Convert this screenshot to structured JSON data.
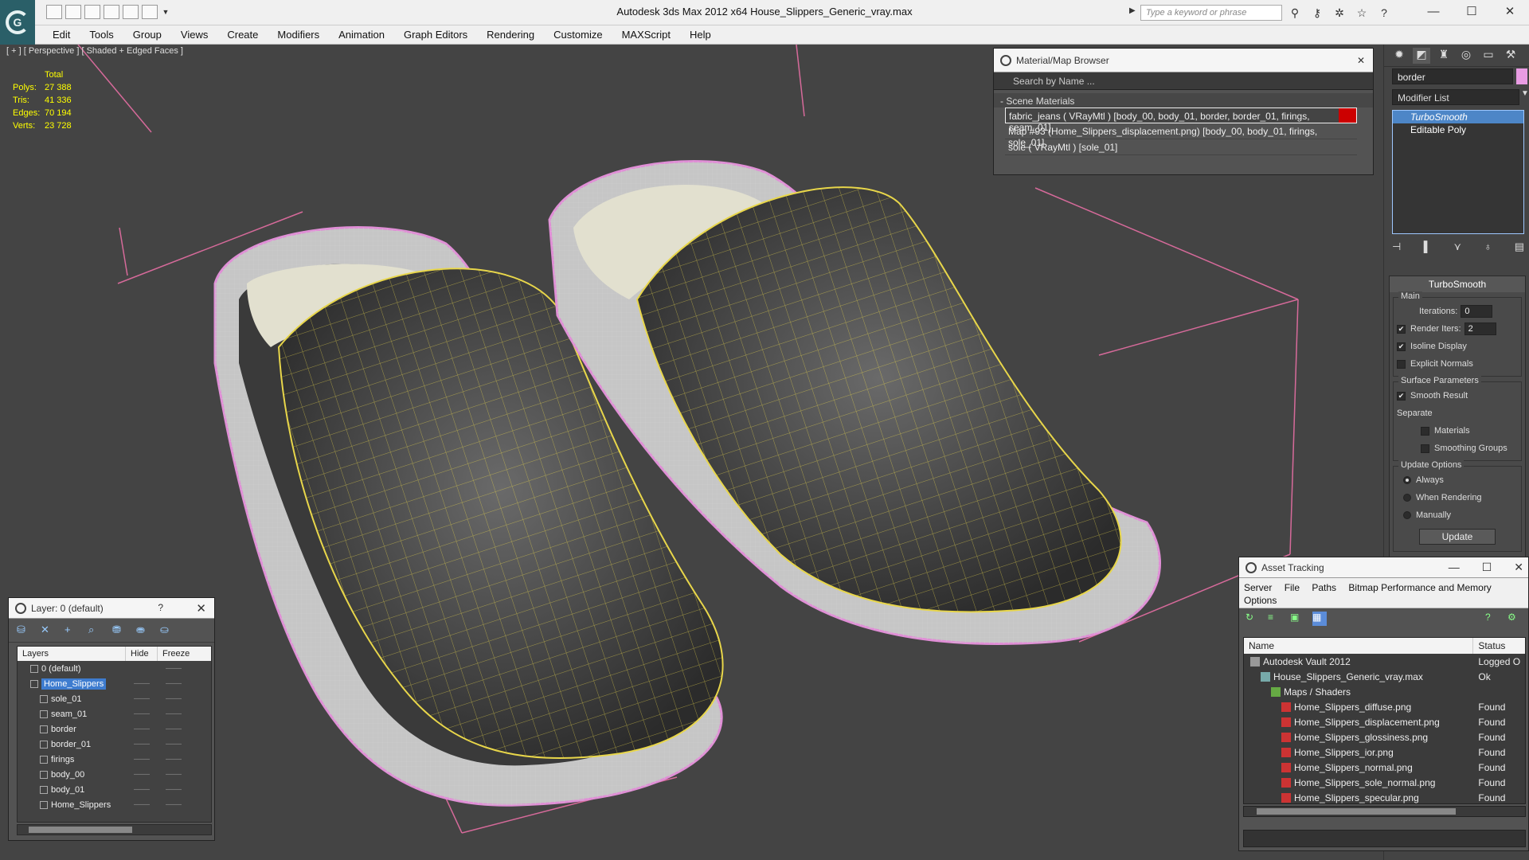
{
  "window": {
    "title": "Autodesk 3ds Max  2012 x64      House_Slippers_Generic_vray.max",
    "search_placeholder": "Type a keyword or phrase",
    "minimize": "—",
    "maximize": "☐",
    "close": "✕"
  },
  "menu": [
    "Edit",
    "Tools",
    "Group",
    "Views",
    "Create",
    "Modifiers",
    "Animation",
    "Graph Editors",
    "Rendering",
    "Customize",
    "MAXScript",
    "Help"
  ],
  "viewport": {
    "label": "[ + ] [ Perspective ] [ Shaded + Edged Faces ]",
    "stats_header": "Total",
    "stats": [
      {
        "k": "Polys:",
        "v": "27 388"
      },
      {
        "k": "Tris:",
        "v": "41 336"
      },
      {
        "k": "Edges:",
        "v": "70 194"
      },
      {
        "k": "Verts:",
        "v": "23 728"
      }
    ]
  },
  "material_browser": {
    "title": "Material/Map Browser",
    "search": "Search by Name ...",
    "section": "- Scene Materials",
    "items": [
      "fabric_jeans  ( VRayMtl )  [body_00, body_01, border, border_01, firings, seam_01]",
      "Map #93 (Home_Slippers_displacement.png) [body_00, body_01, firings, sole_01]",
      "sole  ( VRayMtl )  [sole_01]"
    ],
    "close": "✕"
  },
  "command_panel": {
    "object_name": "border",
    "object_color": "#e99ce3",
    "modifier_list": "Modifier List",
    "stack": [
      "TurboSmooth",
      "Editable Poly"
    ],
    "rollout_title": "TurboSmooth",
    "main_group": "Main",
    "iterations_label": "Iterations:",
    "iterations_value": "0",
    "render_iters_label": "Render Iters:",
    "render_iters_value": "2",
    "isoline": "Isoline Display",
    "explicit_normals": "Explicit Normals",
    "surface_group": "Surface Parameters",
    "smooth_result": "Smooth Result",
    "separate": "Separate",
    "materials": "Materials",
    "smoothing_groups": "Smoothing Groups",
    "update_group": "Update Options",
    "always": "Always",
    "when_rendering": "When Rendering",
    "manually": "Manually",
    "update_button": "Update"
  },
  "layer_window": {
    "title": "Layer: 0 (default)",
    "help": "?",
    "close": "✕",
    "col_layers": "Layers",
    "col_hide": "Hide",
    "col_freeze": "Freeze",
    "rows": [
      {
        "name": "0 (default)",
        "hide": "",
        "freeze": "——",
        "indent": 1
      },
      {
        "name": "Home_Slippers",
        "hide": "——",
        "freeze": "——",
        "indent": 1
      },
      {
        "name": "sole_01",
        "hide": "——",
        "freeze": "——",
        "indent": 2
      },
      {
        "name": "seam_01",
        "hide": "——",
        "freeze": "——",
        "indent": 2
      },
      {
        "name": "border",
        "hide": "——",
        "freeze": "——",
        "indent": 2
      },
      {
        "name": "border_01",
        "hide": "——",
        "freeze": "——",
        "indent": 2
      },
      {
        "name": "firings",
        "hide": "——",
        "freeze": "——",
        "indent": 2
      },
      {
        "name": "body_00",
        "hide": "——",
        "freeze": "——",
        "indent": 2
      },
      {
        "name": "body_01",
        "hide": "——",
        "freeze": "——",
        "indent": 2
      },
      {
        "name": "Home_Slippers",
        "hide": "——",
        "freeze": "——",
        "indent": 2
      }
    ]
  },
  "asset_tracking": {
    "title": "Asset Tracking",
    "menu": [
      "Server",
      "File",
      "Paths",
      "Bitmap Performance and Memory"
    ],
    "menu2": "Options",
    "col_name": "Name",
    "col_status": "Status",
    "rows": [
      {
        "name": "Autodesk Vault 2012",
        "status": "Logged O",
        "level": 1,
        "icon": "vault"
      },
      {
        "name": "House_Slippers_Generic_vray.max",
        "status": "Ok",
        "level": 2,
        "icon": "file"
      },
      {
        "name": "Maps / Shaders",
        "status": "",
        "level": 3,
        "icon": "folder"
      },
      {
        "name": "Home_Slippers_diffuse.png",
        "status": "Found",
        "level": 4,
        "icon": "png"
      },
      {
        "name": "Home_Slippers_displacement.png",
        "status": "Found",
        "level": 4,
        "icon": "png"
      },
      {
        "name": "Home_Slippers_glossiness.png",
        "status": "Found",
        "level": 4,
        "icon": "png"
      },
      {
        "name": "Home_Slippers_ior.png",
        "status": "Found",
        "level": 4,
        "icon": "png"
      },
      {
        "name": "Home_Slippers_normal.png",
        "status": "Found",
        "level": 4,
        "icon": "png"
      },
      {
        "name": "Home_Slippers_sole_normal.png",
        "status": "Found",
        "level": 4,
        "icon": "png"
      },
      {
        "name": "Home_Slippers_specular.png",
        "status": "Found",
        "level": 4,
        "icon": "png"
      }
    ]
  }
}
